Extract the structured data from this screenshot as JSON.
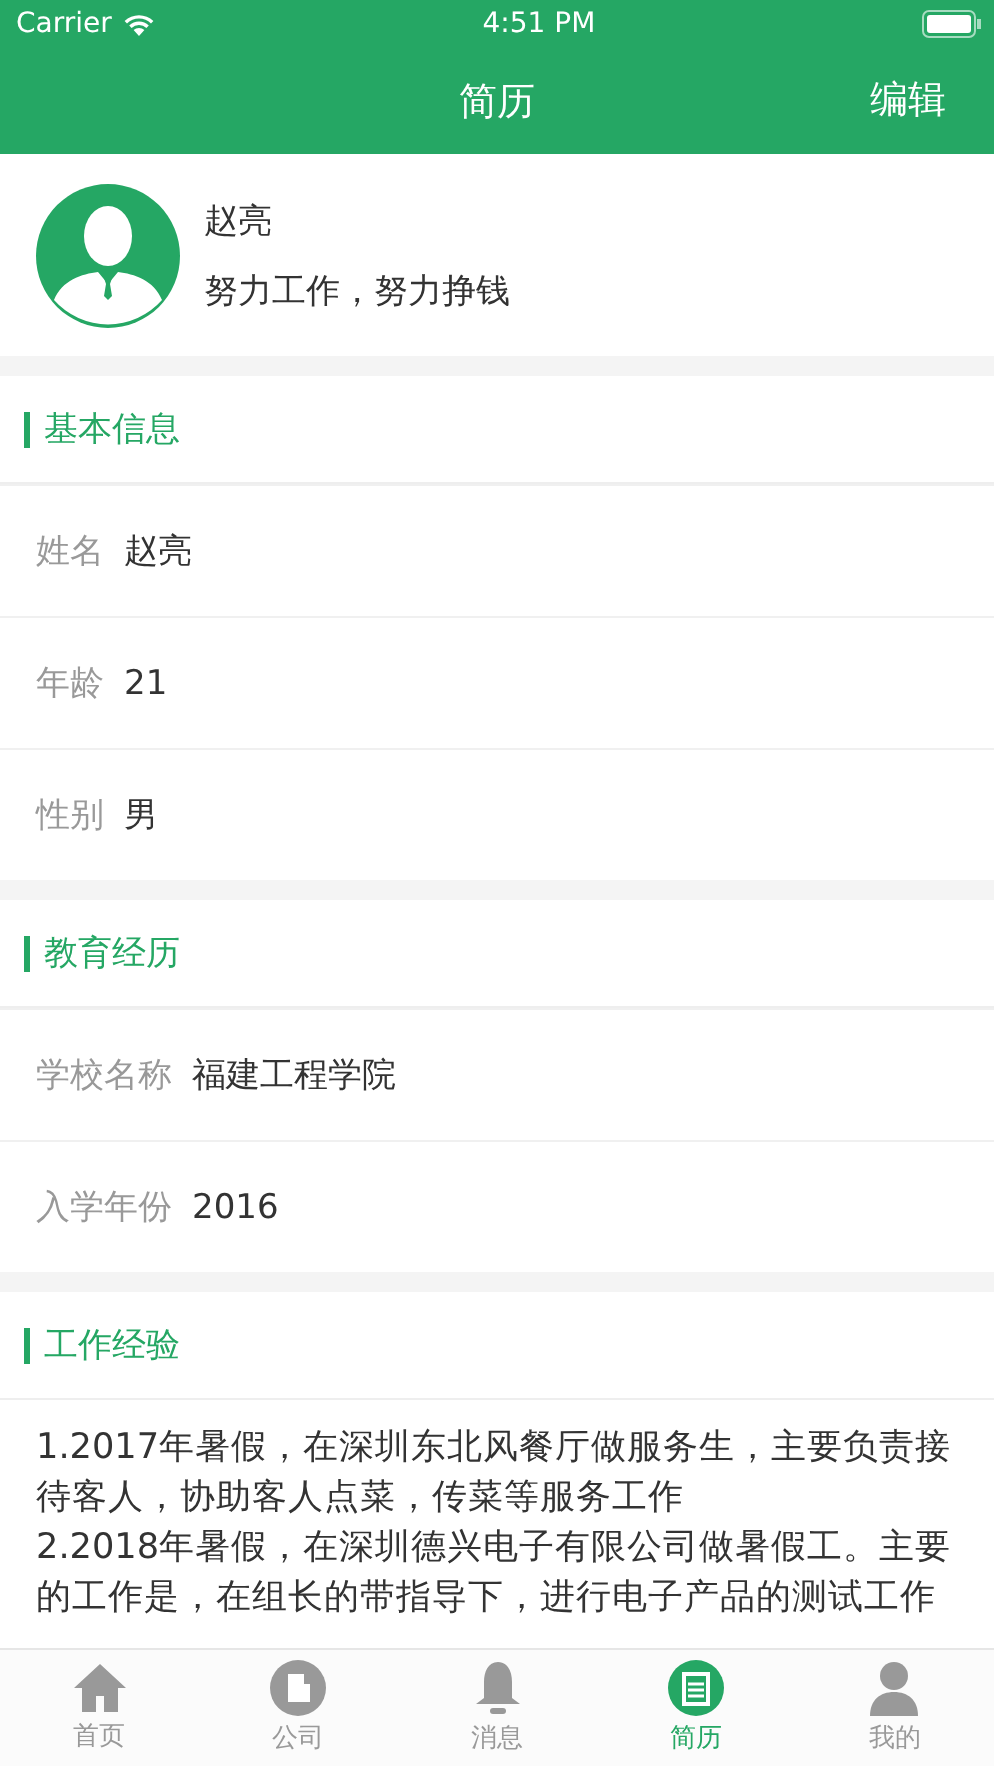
{
  "status_bar": {
    "carrier": "Carrier",
    "time": "4:51 PM"
  },
  "nav": {
    "title": "简历",
    "action": "编辑"
  },
  "profile": {
    "name": "赵亮",
    "motto": "努力工作，努力挣钱"
  },
  "sections": [
    {
      "kind": "fields",
      "title": "基本信息",
      "rows": [
        {
          "label": "姓名",
          "value": "赵亮"
        },
        {
          "label": "年龄",
          "value": "21"
        },
        {
          "label": "性别",
          "value": "男"
        }
      ]
    },
    {
      "kind": "fields",
      "title": "教育经历",
      "rows": [
        {
          "label": "学校名称",
          "value": "福建工程学院"
        },
        {
          "label": "入学年份",
          "value": "2016"
        }
      ]
    },
    {
      "kind": "text",
      "title": "工作经验",
      "paragraphs": [
        "1.2017年暑假，在深圳东北风餐厅做服务生，主要负责接待客人，协助客人点菜，传菜等服务工作",
        "2.2018年暑假，在深圳德兴电子有限公司做暑假工。主要的工作是，在组长的带指导下，进行电子产品的测试工作"
      ]
    }
  ],
  "tabs": [
    {
      "label": "首页",
      "kind": "home",
      "selected": false
    },
    {
      "label": "公司",
      "kind": "company",
      "selected": false
    },
    {
      "label": "消息",
      "kind": "bell",
      "selected": false
    },
    {
      "label": "简历",
      "kind": "resume",
      "selected": true
    },
    {
      "label": "我的",
      "kind": "person",
      "selected": false
    }
  ]
}
